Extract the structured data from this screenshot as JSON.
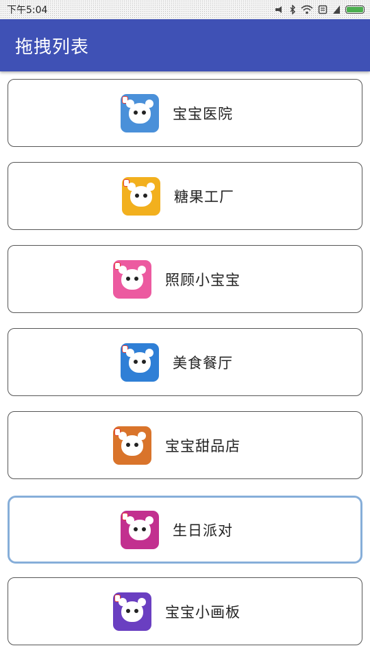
{
  "status_bar": {
    "time": "下午5:04",
    "icons": [
      "bluetooth-icon",
      "wifi-icon",
      "sim-icon",
      "silent-icon",
      "battery-icon"
    ]
  },
  "app_bar": {
    "title": "拖拽列表"
  },
  "items": [
    {
      "label": "宝宝医院",
      "icon": "baby-hospital-app-icon",
      "color": "#4a90d9"
    },
    {
      "label": "糖果工厂",
      "icon": "candy-factory-app-icon",
      "color": "#f2b01e"
    },
    {
      "label": "照顾小宝宝",
      "icon": "baby-care-app-icon",
      "color": "#ec5aa0"
    },
    {
      "label": "美食餐厅",
      "icon": "food-restaurant-app-icon",
      "color": "#2f7fd6"
    },
    {
      "label": "宝宝甜品店",
      "icon": "dessert-shop-app-icon",
      "color": "#d9742b"
    },
    {
      "label": "生日派对",
      "icon": "birthday-party-app-icon",
      "color": "#c2308f"
    },
    {
      "label": "宝宝小画板",
      "icon": "drawing-board-app-icon",
      "color": "#6a3fc1"
    }
  ],
  "selected_index": 5,
  "colors": {
    "app_bar": "#3f51b5",
    "selected_border": "#86aed9",
    "card_border": "#555555"
  }
}
